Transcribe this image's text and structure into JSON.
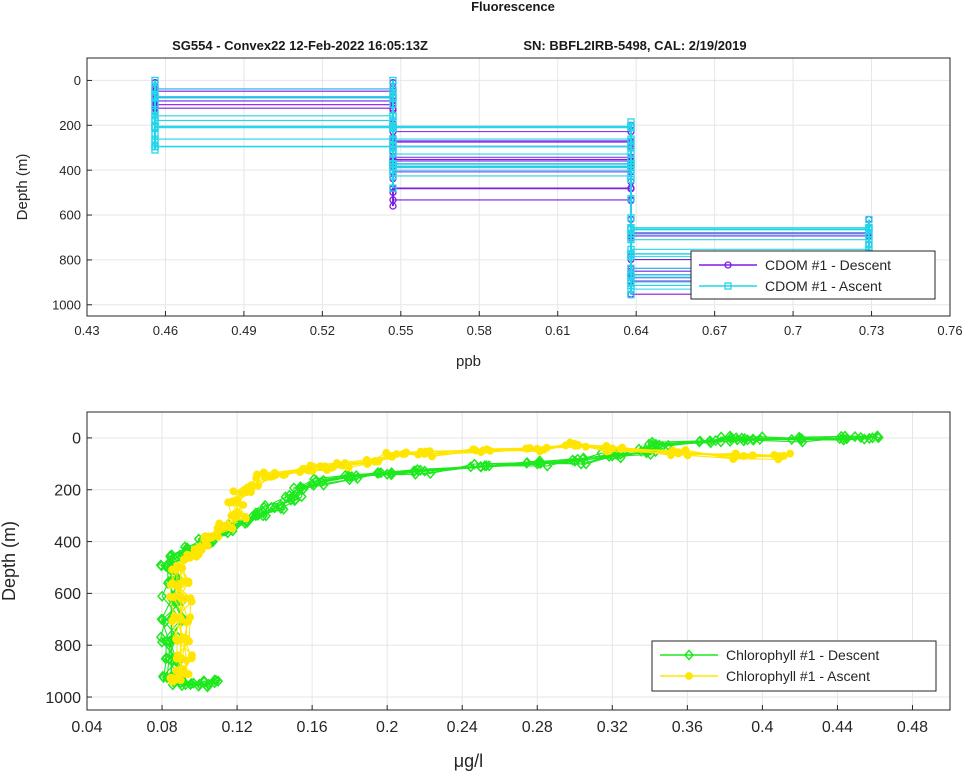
{
  "figure": {
    "title": "Fluorescence",
    "subtitle_left": "SG554 - Convex22 12-Feb-2022 16:05:13Z",
    "subtitle_right": "SN: BBFL2IRB-5498, CAL: 2/19/2019"
  },
  "colors": {
    "cdom_descent": "#7b1ee6",
    "cdom_ascent": "#22d6ea",
    "chl_descent": "#1ee81e",
    "chl_ascent": "#ffe600"
  },
  "chart_data": [
    {
      "type": "line",
      "xlabel": "ppb",
      "ylabel": "Depth (m)",
      "xlim": [
        0.43,
        0.76
      ],
      "ylim": [
        0,
        1000
      ],
      "y_reversed": true,
      "grid": true,
      "legend_location": "bottom-right",
      "xticks": [
        "0.43",
        "0.46",
        "0.49",
        "0.52",
        "0.55",
        "0.58",
        "0.61",
        "0.64",
        "0.67",
        "0.7",
        "0.73",
        "0.76"
      ],
      "yticks": [
        "0",
        "200",
        "400",
        "600",
        "800",
        "1000"
      ],
      "series": [
        {
          "name": "CDOM #1 - Descent",
          "marker": "circle",
          "color": "#7b1ee6",
          "levels": [
            {
              "x": 0.456,
              "depth_range": [
                10,
                140
              ]
            },
            {
              "x": 0.547,
              "depth_range": [
                10,
                560
              ]
            },
            {
              "x": 0.638,
              "depth_range": [
                200,
                955
              ]
            },
            {
              "x": 0.729,
              "depth_range": [
                620,
                955
              ]
            }
          ]
        },
        {
          "name": "CDOM #1 - Ascent",
          "marker": "square",
          "color": "#22d6ea",
          "levels": [
            {
              "x": 0.456,
              "depth_range": [
                0,
                310
              ]
            },
            {
              "x": 0.547,
              "depth_range": [
                0,
                480
              ]
            },
            {
              "x": 0.638,
              "depth_range": [
                185,
                955
              ]
            },
            {
              "x": 0.729,
              "depth_range": [
                620,
                955
              ]
            }
          ]
        }
      ]
    },
    {
      "type": "line",
      "xlabel": "μg/l",
      "ylabel": "Depth (m)",
      "xlim": [
        0.04,
        0.5
      ],
      "ylim": [
        0,
        1000
      ],
      "y_reversed": true,
      "grid": true,
      "legend_location": "bottom-right",
      "xticks": [
        "0.04",
        "0.08",
        "0.12",
        "0.16",
        "0.2",
        "0.24",
        "0.28",
        "0.32",
        "0.36",
        "0.4",
        "0.44",
        "0.48"
      ],
      "yticks": [
        "0",
        "200",
        "400",
        "600",
        "800",
        "1000"
      ],
      "series": [
        {
          "name": "Chlorophyll #1 - Descent",
          "marker": "diamond",
          "color": "#1ee81e",
          "profile": [
            [
              0.457,
              2
            ],
            [
              0.445,
              3
            ],
            [
              0.421,
              4
            ],
            [
              0.395,
              4
            ],
            [
              0.383,
              2
            ],
            [
              0.372,
              12
            ],
            [
              0.345,
              28
            ],
            [
              0.338,
              55
            ],
            [
              0.32,
              70
            ],
            [
              0.3,
              90
            ],
            [
              0.28,
              100
            ],
            [
              0.25,
              112
            ],
            [
              0.22,
              128
            ],
            [
              0.2,
              140
            ],
            [
              0.18,
              150
            ],
            [
              0.165,
              170
            ],
            [
              0.155,
              200
            ],
            [
              0.15,
              230
            ],
            [
              0.14,
              270
            ],
            [
              0.13,
              300
            ],
            [
              0.12,
              330
            ],
            [
              0.112,
              360
            ],
            [
              0.105,
              400
            ],
            [
              0.098,
              430
            ],
            [
              0.09,
              460
            ],
            [
              0.085,
              500
            ],
            [
              0.085,
              550
            ],
            [
              0.085,
              620
            ],
            [
              0.085,
              700
            ],
            [
              0.085,
              780
            ],
            [
              0.085,
              860
            ],
            [
              0.085,
              920
            ],
            [
              0.09,
              945
            ],
            [
              0.1,
              950
            ],
            [
              0.108,
              945
            ]
          ]
        },
        {
          "name": "Chlorophyll #1 - Ascent",
          "marker": "circle-filled",
          "color": "#ffe600",
          "profile": [
            [
              0.41,
              72
            ],
            [
              0.39,
              70
            ],
            [
              0.355,
              55
            ],
            [
              0.32,
              40
            ],
            [
              0.3,
              30
            ],
            [
              0.28,
              42
            ],
            [
              0.25,
              55
            ],
            [
              0.22,
              62
            ],
            [
              0.205,
              62
            ],
            [
              0.19,
              90
            ],
            [
              0.175,
              105
            ],
            [
              0.165,
              112
            ],
            [
              0.155,
              120
            ],
            [
              0.14,
              135
            ],
            [
              0.135,
              150
            ],
            [
              0.128,
              190
            ],
            [
              0.122,
              210
            ],
            [
              0.12,
              250
            ],
            [
              0.12,
              300
            ],
            [
              0.115,
              340
            ],
            [
              0.105,
              380
            ],
            [
              0.1,
              420
            ],
            [
              0.095,
              460
            ],
            [
              0.09,
              500
            ],
            [
              0.09,
              560
            ],
            [
              0.09,
              620
            ],
            [
              0.09,
              700
            ],
            [
              0.09,
              780
            ],
            [
              0.09,
              850
            ],
            [
              0.09,
              900
            ],
            [
              0.09,
              935
            ]
          ]
        }
      ]
    }
  ]
}
